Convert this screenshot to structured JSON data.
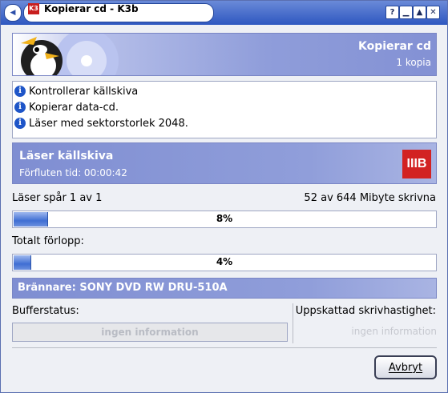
{
  "window": {
    "title": "Kopierar cd - K3b",
    "title_icon": "k3b-icon",
    "buttons": [
      "help",
      "minimize",
      "maximize",
      "close"
    ],
    "button_glyphs": {
      "help": "?",
      "minimize": "▁",
      "maximize": "▲",
      "close": "✕"
    }
  },
  "header": {
    "title": "Kopierar cd",
    "subtitle": "1 kopia"
  },
  "log": {
    "items": [
      {
        "icon": "info-icon",
        "text": "Kontrollerar källskiva"
      },
      {
        "icon": "info-icon",
        "text": "Kopierar data-cd."
      },
      {
        "icon": "info-icon",
        "text": "Läser med sektorstorlek 2048."
      }
    ]
  },
  "status": {
    "title": "Läser källskiva",
    "elapsed": "Förfluten tid: 00:00:42",
    "logo_text": "IIIB"
  },
  "track": {
    "label": "Läser spår 1 av 1",
    "size": "52 av 644 Mibyte skrivna",
    "percent": 8,
    "percent_text": "8%"
  },
  "total": {
    "label": "Totalt förlopp:",
    "percent": 4,
    "percent_text": "4%"
  },
  "burner": {
    "title": "Brännare: SONY DVD RW DRU-510A"
  },
  "buffer": {
    "label": "Bufferstatus:",
    "value": "ingen information"
  },
  "speed": {
    "label": "Uppskattad skrivhastighet:",
    "value": "ingen information"
  },
  "actions": {
    "cancel": "Avbryt"
  },
  "colors": {
    "titlebar": "#2e57c0",
    "section_header": "#8391d4",
    "progress": "#3f6ed3",
    "logo": "#d22222"
  }
}
